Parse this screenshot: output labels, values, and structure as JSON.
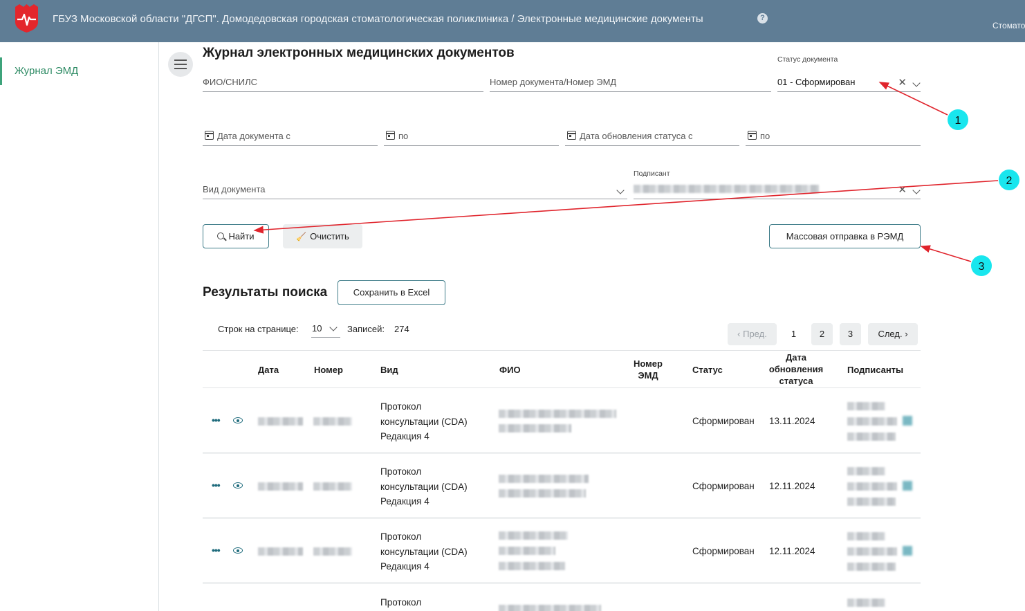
{
  "header": {
    "title": "ГБУЗ Московской области \"ДГСП\". Домодедовская городская стоматологическая поликлиника / Электронные медицинские документы",
    "help_icon": "help-circle-icon",
    "user_truncated": "Стомато"
  },
  "sidebar": {
    "items": [
      {
        "label": "Журнал ЭМД",
        "active": true
      }
    ]
  },
  "page": {
    "title": "Журнал электронных медицинских документов"
  },
  "filters": {
    "fio_placeholder": "ФИО/СНИЛС",
    "doc_number_placeholder": "Номер документа/Номер ЭМД",
    "status": {
      "label": "Статус документа",
      "value": "01 - Сформирован"
    },
    "date_from_placeholder": "Дата документа с",
    "date_to_placeholder": "по",
    "status_date_from_placeholder": "Дата обновления статуса с",
    "status_date_to_placeholder": "по",
    "doc_type_placeholder": "Вид документа",
    "signer": {
      "label": "Подписант"
    }
  },
  "actions": {
    "find": "Найти",
    "clear": "Очистить",
    "mass_send": "Массовая отправка в РЭМД",
    "save_excel": "Сохранить в Excel"
  },
  "results": {
    "title": "Результаты поиска",
    "rows_per_page_label": "Строк на странице:",
    "rows_per_page_value": "10",
    "records_label": "Записей:",
    "records_count": "274"
  },
  "pagination": {
    "prev": "Пред.",
    "pages": [
      "1",
      "2",
      "3"
    ],
    "next": "След.",
    "current": "1"
  },
  "table": {
    "columns": [
      "Дата",
      "Номер",
      "Вид",
      "ФИО",
      "Номер ЭМД",
      "Статус",
      "Дата обновления статуса",
      "Подписанты"
    ],
    "rows": [
      {
        "type": [
          "Протокол",
          "консультации (CDA)",
          "Редакция 4"
        ],
        "status": "Сформирован",
        "status_date": "13.11.2024"
      },
      {
        "type": [
          "Протокол",
          "консультации (CDA)",
          "Редакция 4"
        ],
        "status": "Сформирован",
        "status_date": "12.11.2024"
      },
      {
        "type": [
          "Протокол",
          "консультации (CDA)",
          "Редакция 4"
        ],
        "status": "Сформирован",
        "status_date": "12.11.2024"
      },
      {
        "type": [
          "Протокол"
        ]
      }
    ]
  },
  "annotations": [
    "1",
    "2",
    "3"
  ],
  "colors": {
    "header_bg": "#5f7d95",
    "accent_green": "#2c8a63",
    "button_border": "#3d7b88",
    "annotation_arrow": "#e0242c",
    "annotation_circle": "#19e6ee"
  }
}
